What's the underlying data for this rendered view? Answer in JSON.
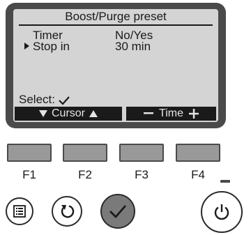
{
  "screen": {
    "title": "Boost/Purge preset",
    "rows": [
      {
        "label": "Timer",
        "value": "No/Yes",
        "selected": false
      },
      {
        "label": "Stop in",
        "value": "30 min",
        "selected": true
      }
    ],
    "select_label": "Select:",
    "softkeys": {
      "left_label": "Cursor",
      "right_label": "Time"
    }
  },
  "function_keys": [
    "F1",
    "F2",
    "F3",
    "F4"
  ],
  "buttons": {
    "menu_icon": "menu-icon",
    "return_icon": "return-icon",
    "select_icon": "check-icon",
    "power_icon": "power-icon"
  },
  "colors": {
    "screen_bg": "#d4d4d4",
    "bezel": "#4a4a4a",
    "key_fill": "#999999",
    "select_button": "#7a7a7a"
  }
}
